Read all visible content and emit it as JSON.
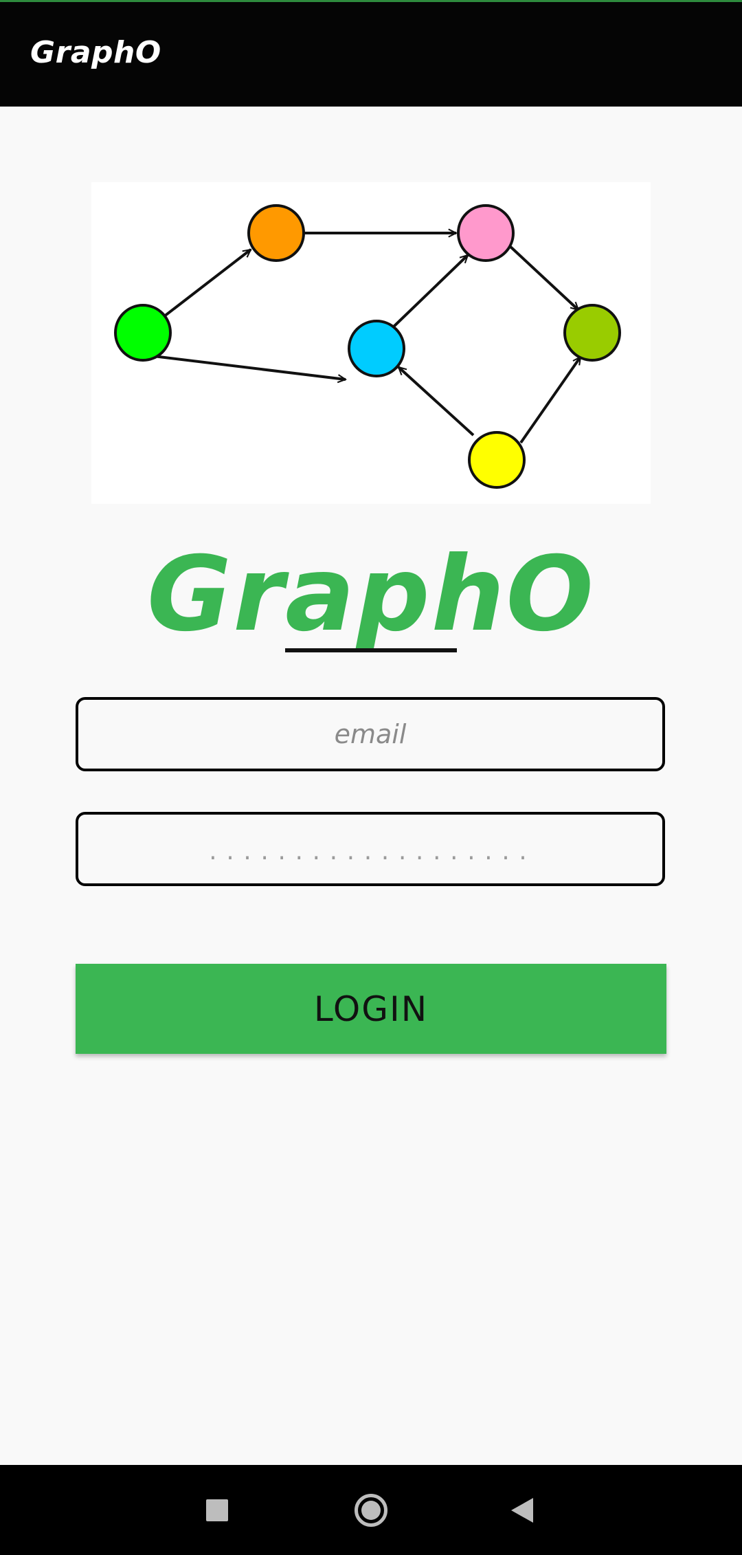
{
  "app_bar": {
    "title": "GraphO"
  },
  "logo": {
    "title": "GraphO"
  },
  "login_form": {
    "email_placeholder": "email",
    "password_value": "",
    "password_dots": "...................",
    "login_label": "LOGIN"
  },
  "graph_nodes": {
    "colors": [
      "#00ff00",
      "#ff9900",
      "#00ccff",
      "#ff99cc",
      "#99cc00",
      "#ffff00"
    ]
  },
  "colors": {
    "accent": "#3bb653",
    "app_bar": "#050505",
    "background": "#f9f9f9"
  },
  "icons": {
    "nav_recent": "square-recent-apps-icon",
    "nav_home": "circle-home-icon",
    "nav_back": "triangle-back-icon"
  }
}
